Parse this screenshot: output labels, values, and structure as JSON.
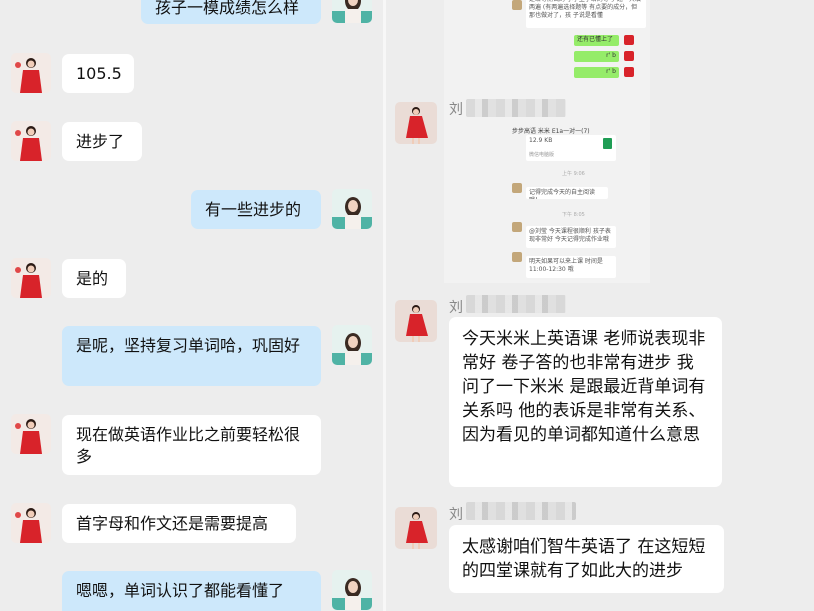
{
  "left_chat": {
    "messages": [
      {
        "side": "right",
        "text": "孩子一模成绩怎么样"
      },
      {
        "side": "left",
        "text": "105.5"
      },
      {
        "side": "left",
        "text": "进步了"
      },
      {
        "side": "right",
        "text": "有一些进步的"
      },
      {
        "side": "left",
        "text": "是的"
      },
      {
        "side": "right",
        "text": "是呢，坚持复习单词哈，巩固好"
      },
      {
        "side": "left",
        "text": "现在做英语作业比之前要轻松很多"
      },
      {
        "side": "left",
        "text": "首字母和作文还是需要提高"
      },
      {
        "side": "right",
        "text": "嗯嗯，单词认识了都能看懂了"
      }
    ]
  },
  "right_chat": {
    "sender_prefix": "刘",
    "screenshot": {
      "top_text": "是给等测试的 小学生子给的等号 题一共填两遍 (有两遍选择题等 有点要的成分，但那也做对了，孩 子说是看懂",
      "reply_1": "还有已懂上了",
      "reply_2": "r' b",
      "reply_3": "r' b",
      "header": "步步高语 米米 E1a一对一(7)",
      "file_size": "12.9 KB",
      "file_label": "微信电脑版",
      "time_1": "上午 9:06",
      "msg_1": "记得完成今天的自主阅读哦！",
      "time_2": "下午 8:05",
      "msg_2": "@刘莹 今天课程很顺利 孩子表现非常好 今天记得完成作业哦",
      "msg_3": "明天如果可以来上课 时间是 11:00-12:30 哦"
    },
    "message_1": "今天米米上英语课 老师说表现非常好 卷子答的也非常有进步 我问了一下米米 是跟最近背单词有关系吗 他的表诉是非常有关系、因为看见的单词都知道什么意思",
    "message_2": "太感谢咱们智牛英语了 在这短短的四堂课就有了如此大的进步"
  },
  "colors": {
    "background": "#ededed",
    "incoming_bubble": "#ffffff",
    "outgoing_bubble": "#cde8fb",
    "wechat_green": "#95ec69"
  },
  "icons": [
    "avatar-red-dress-icon",
    "avatar-teacher-icon",
    "file-excel-icon"
  ]
}
